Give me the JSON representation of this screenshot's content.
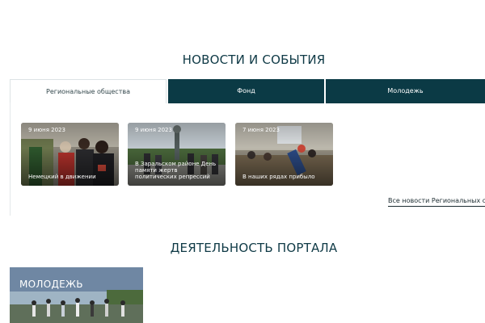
{
  "news": {
    "title": "НОВОСТИ И СОБЫТИЯ",
    "tabs": [
      {
        "label": "Региональные общества",
        "active": true
      },
      {
        "label": "Фонд",
        "active": false
      },
      {
        "label": "Молодежь",
        "active": false
      }
    ],
    "cards": [
      {
        "date": "9 июня 2023",
        "caption": "Немецкий в движении"
      },
      {
        "date": "9 июня 2023",
        "caption": "В Заральском районе День памяти жертв политических репрессий"
      },
      {
        "date": "7 июня 2023",
        "caption": "В наших рядах прибыло"
      }
    ],
    "all_news_link": "Все новости Региональных общес"
  },
  "portal": {
    "title": "ДЕЯТЕЛЬНОСТЬ ПОРТАЛА",
    "cards": [
      {
        "label": "МОЛОДЕЖЬ"
      }
    ]
  },
  "colors": {
    "accent": "#0b3a45",
    "title": "#0f3a46"
  }
}
